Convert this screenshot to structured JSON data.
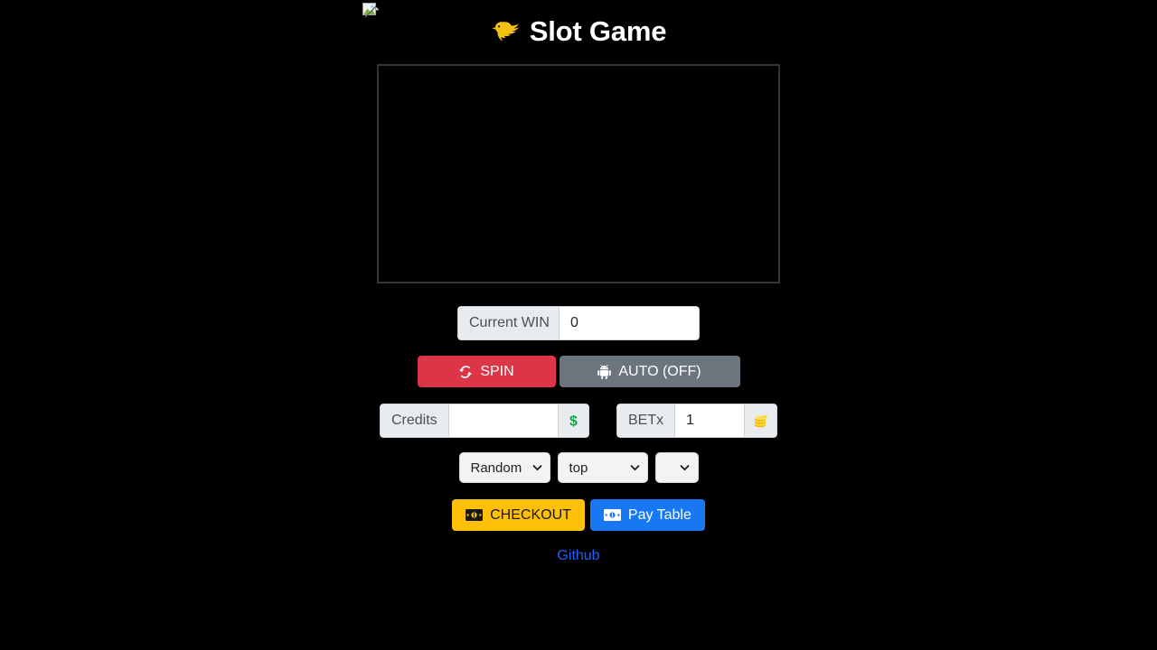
{
  "header": {
    "broken_image_icon": "broken-image-icon",
    "bird_icon": "bird-icon",
    "title": "Slot Game"
  },
  "reels": {
    "name": "slot-reel-canvas",
    "background_color": "#000000",
    "border_color": "#31363b"
  },
  "win": {
    "label": "Current WIN",
    "value": "0",
    "placeholder": ""
  },
  "actions": {
    "spin_label": "SPIN",
    "spin_icon": "sync-icon",
    "spin_color": "#dc3545",
    "auto_label": "AUTO (OFF)",
    "auto_icon": "android-icon",
    "auto_color": "#6c757d"
  },
  "credits": {
    "label": "Credits",
    "value": "",
    "placeholder": "",
    "button_icon": "dollar-sign-icon",
    "button_icon_glyph": "💲"
  },
  "bet": {
    "label": "BETx",
    "value": "1",
    "placeholder": "",
    "button_icon": "coin-stack-icon",
    "button_icon_glyph": "🪙"
  },
  "selects": {
    "mode": {
      "value": "Random",
      "options": [
        "Random"
      ]
    },
    "position": {
      "value": "top",
      "options": [
        "top"
      ]
    },
    "extra": {
      "value": "",
      "options": []
    }
  },
  "checkout": {
    "checkout_label": "CHECKOUT",
    "checkout_icon": "money-bill-icon",
    "checkout_color": "#ffc107",
    "paytable_label": "Pay Table",
    "paytable_icon": "money-bill-icon",
    "paytable_color": "#1877f2"
  },
  "footer": {
    "link_label": "Github",
    "link_color": "#2160f7"
  }
}
